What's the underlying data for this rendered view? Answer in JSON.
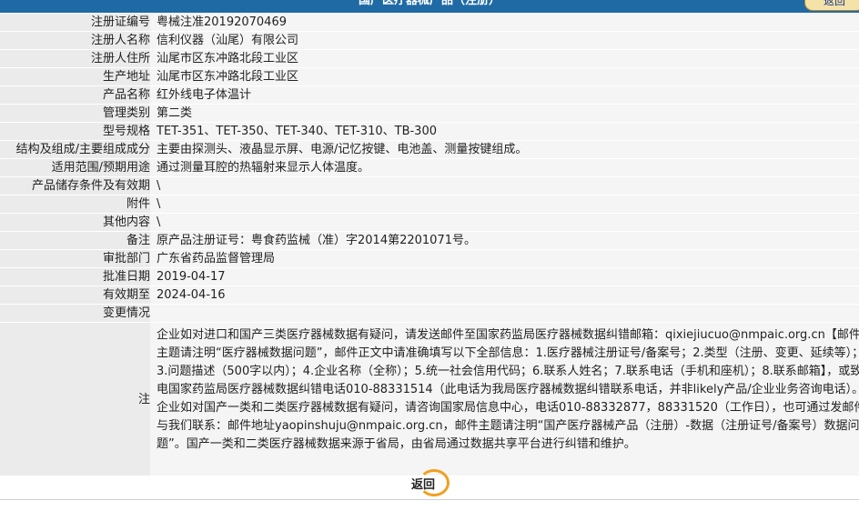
{
  "header": {
    "title": "国产医疗器械产品（注册）",
    "back_label": "返回"
  },
  "rows": [
    {
      "label": "注册证编号",
      "value": "粤械注准20192070469"
    },
    {
      "label": "注册人名称",
      "value": "信利仪器（汕尾）有限公司"
    },
    {
      "label": "注册人住所",
      "value": "汕尾市区东冲路北段工业区"
    },
    {
      "label": "生产地址",
      "value": "汕尾市区东冲路北段工业区"
    },
    {
      "label": "产品名称",
      "value": "红外线电子体温计"
    },
    {
      "label": "管理类别",
      "value": "第二类"
    },
    {
      "label": "型号规格",
      "value": "TET-351、TET-350、TET-340、TET-310、TB-300"
    },
    {
      "label": "结构及组成/主要组成成分",
      "value": "主要由探测头、液晶显示屏、电源/记忆按键、电池盖、测量按键组成。"
    },
    {
      "label": "适用范围/预期用途",
      "value": "通过测量耳腔的热辐射来显示人体温度。"
    },
    {
      "label": "产品储存条件及有效期",
      "value": "\\"
    },
    {
      "label": "附件",
      "value": "\\"
    },
    {
      "label": "其他内容",
      "value": "\\"
    },
    {
      "label": "备注",
      "value": "原产品注册证号：粤食药监械（准）字2014第2201071号。"
    },
    {
      "label": "审批部门",
      "value": "广东省药品监督管理局"
    },
    {
      "label": "批准日期",
      "value": "2019-04-17"
    },
    {
      "label": "有效期至",
      "value": "2024-04-16"
    },
    {
      "label": "变更情况",
      "value": ""
    }
  ],
  "note": {
    "label": "注",
    "text": "企业如对进口和国产三类医疗器械数据有疑问，请发送邮件至国家药监局医疗器械数据纠错邮箱：qixiejiucuo@nmpaic.org.cn【邮件主题请注明“医疗器械数据问题”，邮件正文中请准确填写以下全部信息：1.医疗器械注册证号/备案号；2.类型（注册、变更、延续等）；3.问题描述（500字以内）；4.企业名称（全称）；5.统一社会信用代码；6.联系人姓名；7.联系电话（手机和座机）；8.联系邮箱】，或致电国家药监局医疗器械数据纠错电话010-88331514（此电话为我局医疗器械数据纠错联系电话，并非likely产品/企业业务咨询电话）。企业如对国产一类和二类医疗器械数据有疑问，请咨询国家局信息中心，电话010-88332877，88331520（工作日），也可通过发邮件与我们联系：邮件地址yaopinshuju@nmpaic.org.cn，邮件主题请注明“国产医疗器械产品（注册）-数据（注册证号/备案号）数据问题”。国产一类和二类医疗器械数据来源于省局，由省局通过数据共享平台进行纠错和维护。"
  },
  "footer": {
    "back_label": "返回"
  }
}
